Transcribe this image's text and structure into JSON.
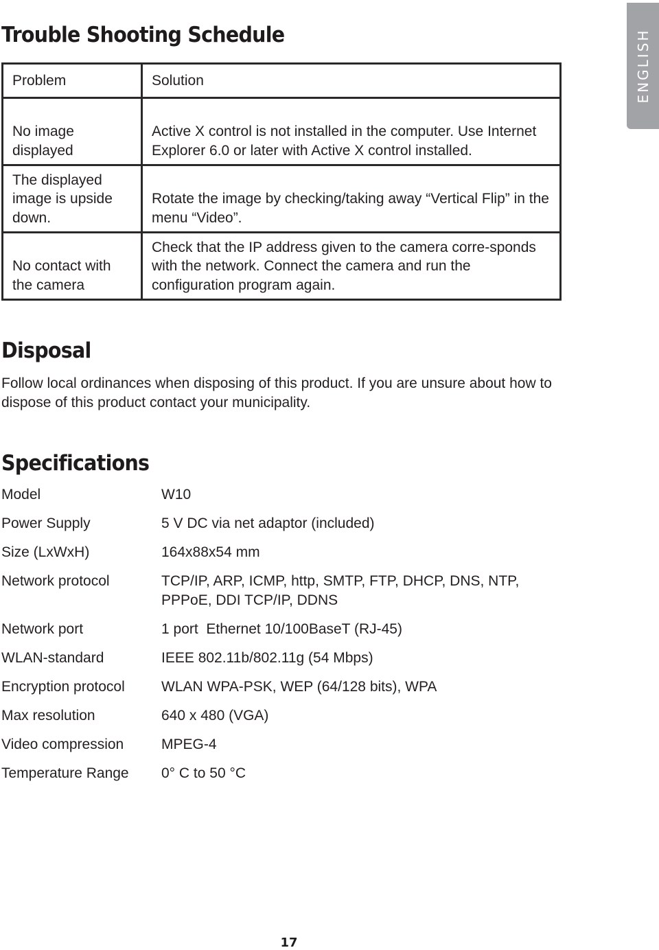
{
  "language_tab": "ENGLISH",
  "troubleshooting": {
    "title": "Trouble Shooting Schedule",
    "headers": {
      "problem": "Problem",
      "solution": "Solution"
    },
    "rows": [
      {
        "problem": "No image displayed",
        "solution": "Active X control is not installed in the computer. Use Internet Explorer 6.0 or later with Active X control installed."
      },
      {
        "problem": "The displayed image is upside down.",
        "solution": "Rotate the image by checking/taking away “Vertical Flip” in the menu “Video”."
      },
      {
        "problem": "No contact with the camera",
        "solution": "Check that the IP address given to the camera corre-sponds with the network. Connect the camera and run the configuration program again."
      }
    ]
  },
  "disposal": {
    "title": "Disposal",
    "text": "Follow local ordinances when disposing of this product. If you are unsure about how to dispose of this product contact your municipality."
  },
  "specifications": {
    "title": "Specifications",
    "rows": [
      {
        "label": "Model",
        "value": "W10"
      },
      {
        "label": "Power Supply",
        "value": "5 V DC via net adaptor (included)"
      },
      {
        "label": "Size (LxWxH)",
        "value": "164x88x54 mm"
      },
      {
        "label": "Network protocol",
        "value": "TCP/IP, ARP, ICMP, http, SMTP, FTP, DHCP, DNS, NTP, PPPoE, DDI TCP/IP, DDNS"
      },
      {
        "label": "Network port",
        "value": "1 port  Ethernet 10/100BaseT (RJ-45)"
      },
      {
        "label": "WLAN-standard",
        "value": "IEEE 802.11b/802.11g (54 Mbps)"
      },
      {
        "label": "Encryption protocol",
        "value": "WLAN WPA-PSK, WEP (64/128 bits), WPA"
      },
      {
        "label": "Max resolution",
        "value": "640 x 480 (VGA)"
      },
      {
        "label": "Video compression",
        "value": "MPEG-4"
      },
      {
        "label": "Temperature Range",
        "value": "0° C to 50 °C"
      }
    ]
  },
  "page_number": "17"
}
